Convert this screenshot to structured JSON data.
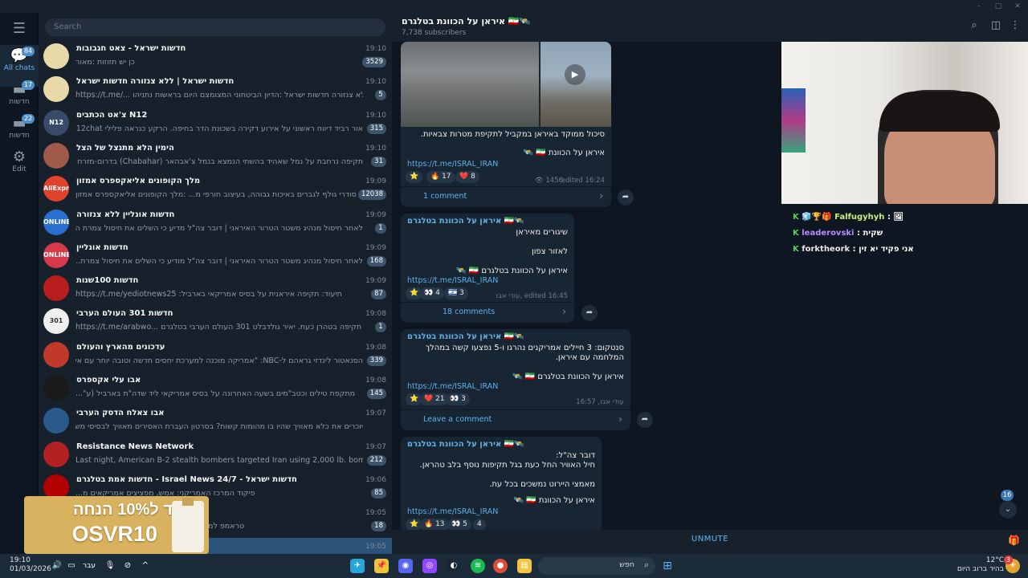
{
  "window": {
    "min_icon": "minimize-icon",
    "max_icon": "maximize-icon",
    "close_icon": "close-icon"
  },
  "rail": {
    "menu_icon": "hamburger-icon",
    "items": [
      {
        "label": "All chats",
        "badge": "84",
        "icon": "chat-bubbles-icon"
      },
      {
        "label": "חדשות",
        "badge": "17",
        "icon": "folder-icon"
      },
      {
        "label": "חדשות",
        "badge": "22",
        "icon": "folder-icon"
      },
      {
        "label": "Edit",
        "badge": "",
        "icon": "sliders-icon"
      }
    ]
  },
  "search": {
    "placeholder": "Search"
  },
  "chats": [
    {
      "name": "חדשות ישראל - צאט חגבובות",
      "time": "19:10",
      "preview": "כן יש תזוזות :מאור",
      "badge": "3529",
      "avatar_text": "",
      "color": "#e8d9a8"
    },
    {
      "name": "חדשות ישראל | ללא צנזורה חדשות ישראל",
      "time": "19:10",
      "preview": "https://t.me/...  ללא צנזורה חדשות ישראל :הדיון הביטחוני המצומצם היום בראשות נתניהו",
      "badge": "5",
      "avatar_text": "",
      "color": "#e8d9a8"
    },
    {
      "name": "צ'אט הכתבים N12",
      "time": "19:10",
      "preview": "אור רביד דיווח ראשוני על אירוע דקירה בשכונת הדר בחיפה. הרקע כנראה פלילי N12chat@",
      "badge": "315",
      "avatar_text": "N12",
      "color": "#3a4a6a"
    },
    {
      "name": "הימין הלא מתנצל של הצל",
      "time": "19:10",
      "preview": "תקיפה נרחבת על נמל שאהיד בהשתי הנמצא בנמל צ'אבהאר (Chabahar) בדרום-מזרח אי...",
      "badge": "31",
      "avatar_text": "",
      "color": "#a05a4a"
    },
    {
      "name": "מלך הקופונים אליאקספרס אמזון",
      "time": "19:09",
      "preview": "סודרי גולף לגברים באיכות גבוהה, בעיצוב חורפי מ... :מלך הקופונים אליאקספרס אמזון",
      "badge": "12038",
      "avatar_text": "AliExpress",
      "color": "#e0432b"
    },
    {
      "name": "חדשות אונליין ללא צנזורה",
      "time": "19:09",
      "preview": "לאחר חיסול מנהיג משטר הטרור האיראני | דובר צה\"ל מדיע כי השלים את חיסול צמרת ה...",
      "badge": "1",
      "avatar_text": "ONLINE",
      "color": "#2a6fd0"
    },
    {
      "name": "חדשות אונליין",
      "time": "19:09",
      "preview": "לאחר חיסול מנהיג משטר הטרור האיראני | דובר צה\"ל מודיע כי השלים את חיסול צמרת...",
      "badge": "168",
      "avatar_text": "ONLINE",
      "color": "#d43a4a"
    },
    {
      "name": "חדשות 100שנות",
      "time": "19:09",
      "preview": "https://t.me/yediotnews25 :תיעוד: תקיפה איראנית על בסיס אמריקאי בארביל",
      "badge": "87",
      "avatar_text": "",
      "color": "#b81d1d"
    },
    {
      "name": "חדשות 301 העולם הערבי",
      "time": "19:08",
      "preview": "https://t.me/arabwo... ראשוני: תקיפה בטהרן כעת. יאיר גולדבלט 301 העולם הערבי בטלגרם",
      "badge": "1",
      "avatar_text": "301",
      "color": "#f0f0f0"
    },
    {
      "name": "עדכונים מהארץ והעולם",
      "time": "19:08",
      "preview": "הסנאטור לינדזי גראהם ל-NBC: \"אמריקה מוכנה למערכת יחסים חדשה וטובה יותר עם אירא...",
      "badge": "339",
      "avatar_text": "",
      "color": "#c0392b"
    },
    {
      "name": "אבו עלי אקספרס",
      "time": "19:08",
      "preview": "מתקפת טילים וכטב\"מים בשעה האחרונה על בסיס אמריקאי ליד שדה\"ת בארביל (ע\"...",
      "badge": "145",
      "avatar_text": "",
      "color": "#1a1a1a"
    },
    {
      "name": "אבו צאלח הדסק הערבי",
      "time": "19:07",
      "preview": "יוכרים את כלא מאוויך שהיו בו מהומות קשות?  בסרטון העברת האסירים מאוויך לבסיסי משמרו...",
      "badge": "",
      "avatar_text": "",
      "color": "#2a5a8a"
    },
    {
      "name": "Resistance News Network",
      "time": "19:07",
      "preview": "Last night, American B-2 stealth bombers targeted Iran using 2,000 lb. bombs, accordin...",
      "badge": "212",
      "avatar_text": "",
      "color": "#b22222"
    },
    {
      "name": "חדשות אמת בטלגרם - Israel News 24/7 - חדשות ישראל",
      "time": "19:06",
      "preview": "פיקוד המרכז האמריקני: אמש, מפציצים אמריקאים מ...",
      "badge": "85",
      "avatar_text": "",
      "color": "#b30000"
    },
    {
      "name": "אופק",
      "time": "19:05",
      "preview": "טראמפ למגזין \"האטלנטיק\": ההנהגה החדשה באי...",
      "badge": "18",
      "avatar_text": "",
      "color": "#3a3a3a"
    },
    {
      "name": "",
      "time": "19:05",
      "preview": "",
      "badge": "",
      "avatar_text": "",
      "color": "#2b5278"
    }
  ],
  "ad": {
    "line1": "קוד ל10% הנחה",
    "line2": "OSVR10"
  },
  "conversation": {
    "title": "איראן על הכוונת בטלגרם 🇮🇷🛰️",
    "subscribers": "7,738 subscribers",
    "header_icons": [
      "search-icon",
      "sidebar-toggle-icon",
      "more-vertical-icon"
    ],
    "posts": [
      {
        "text_lines": [
          "סיכול ממוקד באיראן במקביל לתקיפת מטרות צבאיות."
        ],
        "signature": "איראן על הכוונת 🇮🇷 🛰️",
        "link": "https://t.me/ISRAL_IRAN",
        "reactions": [
          "⭐",
          "🔥 17",
          "❤️ 8"
        ],
        "views": "1456",
        "time": "edited 16:24",
        "comments": "1 comment"
      },
      {
        "channel": "איראן על הכוונת בטלגרם 🇮🇷🛰️",
        "text_lines": [
          "שיגורים מאיראן",
          "לאזור צפון"
        ],
        "signature": "איראן על הכוונת בטלגרם 🇮🇷 🛰️",
        "link": "https://t.me/ISRAL_IRAN",
        "reactions": [
          "⭐",
          "👀 4",
          "🇮🇱 3"
        ],
        "views": "1421",
        "time": "עודי אבו, edited 16:45",
        "comments": "18 comments"
      },
      {
        "channel": "איראן על הכוונת בטלגרם 🇮🇷🛰️",
        "text_lines": [
          "סנטקום: 3 חיילים אמריקנים נהרגו ו-5 נפצעו קשה במהלך",
          "המלחמה עם איראן."
        ],
        "signature": "איראן על הכוונת בטלגרם 🇮🇷 🛰️",
        "link": "https://t.me/ISRAL_IRAN",
        "reactions": [
          "⭐",
          "❤️ 21",
          "👀 3"
        ],
        "views": "1282",
        "time": "עודי אבו, 16:57",
        "comments": "Leave a comment"
      },
      {
        "channel": "איראן על הכוונת בטלגרם 🇮🇷🛰️",
        "text_lines": [
          "דובר צה\"ל:",
          "חיל האוויר החל כעת בגל תקיפות נוסף בלב טהראן.",
          "",
          "מאמצי היירוט נמשכים בכל עת."
        ],
        "signature": "איראן על הכוונת 🇮🇷 🛰️",
        "link": "https://t.me/ISRAL_IRAN",
        "reactions": [
          "⭐",
          "🔥 13",
          "👀 5",
          "4"
        ],
        "views": "",
        "time": "",
        "comments": ""
      }
    ],
    "scroll_badge": "16",
    "unmute": "UNMUTE"
  },
  "stream_chat": [
    {
      "user": "Falfugyhyh",
      "text": ""
    },
    {
      "user": "leaderovski",
      "text": "שקית"
    },
    {
      "user": "forktheork",
      "text": "אני פקיד יא זין"
    }
  ],
  "taskbar": {
    "time": "19:10",
    "date": "01/03/2026",
    "lang": "עבר",
    "search": "חפש",
    "temp": "12°C",
    "weather": "בהיר ברוב היום",
    "notif": "3"
  }
}
